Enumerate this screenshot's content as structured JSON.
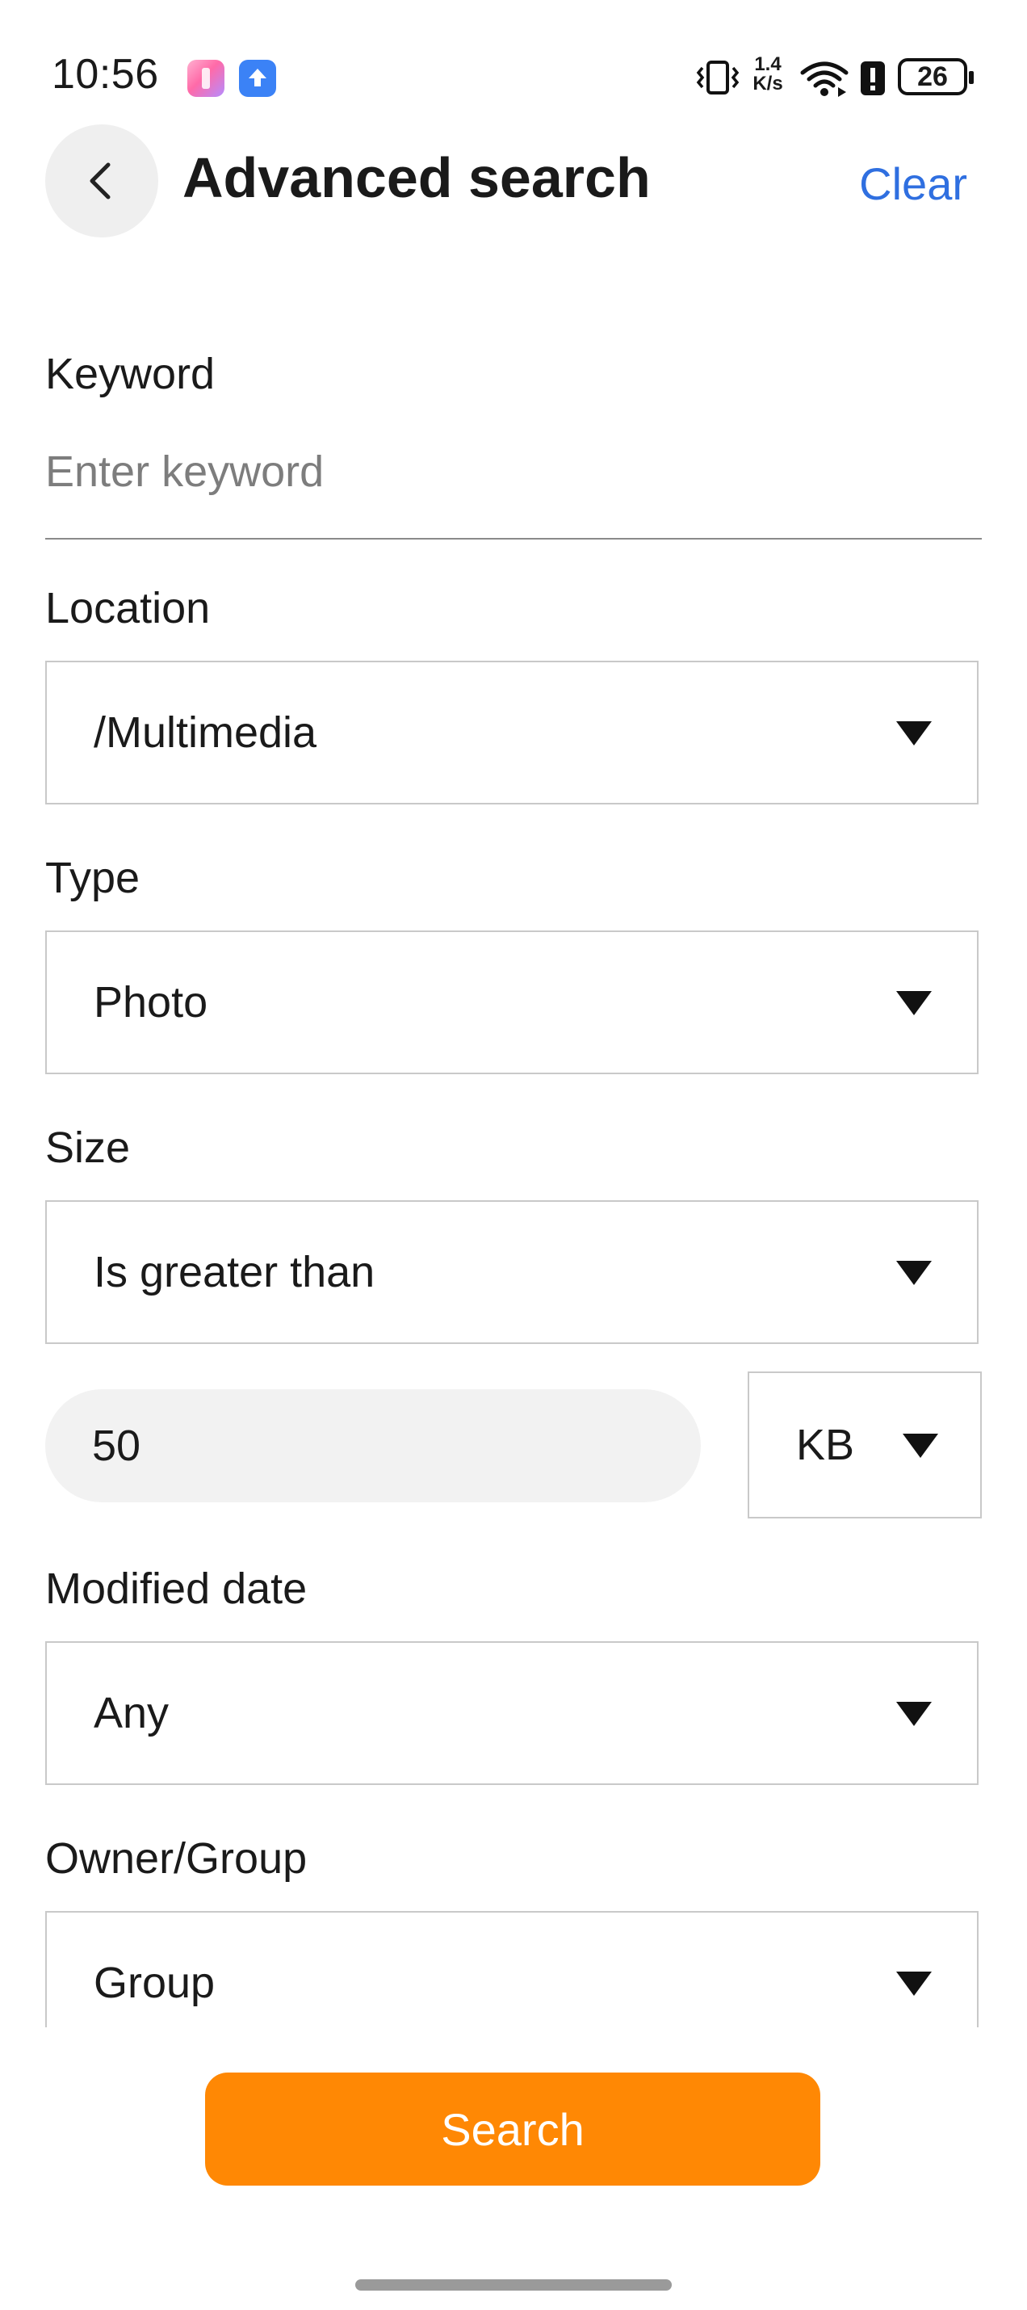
{
  "status_bar": {
    "time": "10:56",
    "net_speed_top": "1.4",
    "net_speed_bottom": "K/s",
    "battery": "26",
    "icons": [
      "app-notification-icon",
      "upload-app-icon",
      "vibrate-icon",
      "wifi-icon",
      "alert-icon",
      "battery-icon"
    ]
  },
  "header": {
    "title": "Advanced search",
    "clear_label": "Clear",
    "back_icon": "chevron-left-icon"
  },
  "form": {
    "keyword": {
      "label": "Keyword",
      "placeholder": "Enter keyword",
      "value": ""
    },
    "location": {
      "label": "Location",
      "value": "/Multimedia"
    },
    "type": {
      "label": "Type",
      "value": "Photo"
    },
    "size": {
      "label": "Size",
      "comparator": "Is greater than",
      "value": "50",
      "unit": "KB"
    },
    "modified_date": {
      "label": "Modified date",
      "value": "Any"
    },
    "owner_group": {
      "label": "Owner/Group",
      "value": "Group"
    }
  },
  "actions": {
    "search_label": "Search"
  },
  "colors": {
    "accent_orange": "#ff8804",
    "link_blue": "#2f6fe0",
    "input_bg": "#f2f2f2",
    "border": "#c9c9c9"
  }
}
